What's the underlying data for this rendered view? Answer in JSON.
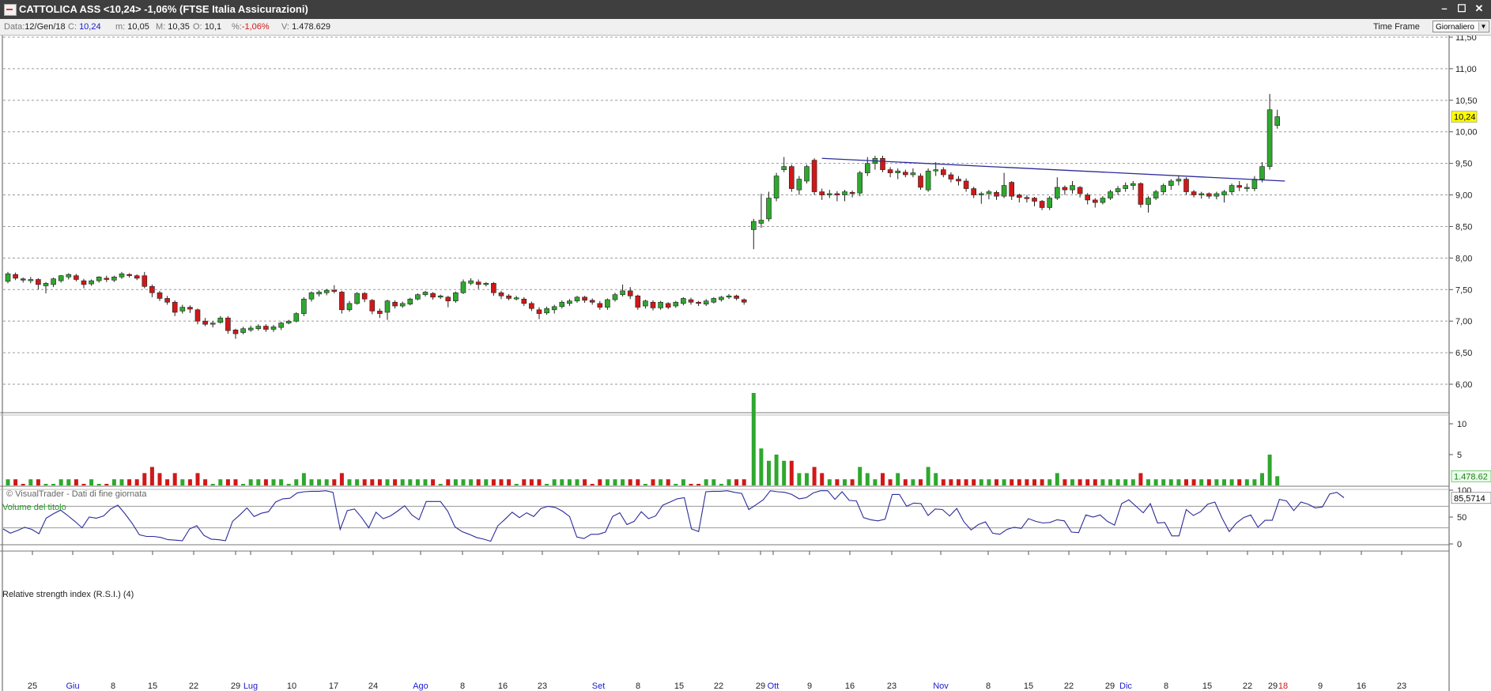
{
  "window": {
    "title": "CATTOLICA ASS <10,24>  -1,06%  (FTSE Italia Assicurazioni)",
    "buttons": [
      "–",
      "☐",
      "✕"
    ]
  },
  "infobar": {
    "data_label": "Data:",
    "data_value": "12/Gen/18",
    "close_label": "C:",
    "close_value": "10,24",
    "min_label": "m:",
    "min_value": "10,05",
    "max_label": "M:",
    "max_value": "10,35",
    "open_label": "O:",
    "open_value": "10,1",
    "pct_label": "%:",
    "pct_value": "-1,06%",
    "vol_label": "V:",
    "vol_value": "1.478.629",
    "timeframe_label": "Time Frame",
    "timeframe_value": "Giornaliero"
  },
  "colors": {
    "up": "#2ea82e",
    "down": "#d01818",
    "line": "#2b2b9a",
    "last_price_bg": "#ffff00"
  },
  "price_panel": {
    "watermark": "© VisualTrader - Dati di fine giornata",
    "axis_ticks": [
      "11,50",
      "11,00",
      "10,50",
      "10,00",
      "9,50",
      "9,00",
      "8,50",
      "8,00",
      "7,50",
      "7,00",
      "6,50",
      "6,00"
    ],
    "last_price": "10,24"
  },
  "volume_panel": {
    "title": "Volume del titolo",
    "axis_ticks": [
      "10",
      "5"
    ],
    "last_value": "1.478.62"
  },
  "rsi_panel": {
    "title": "Relative strength index (R.S.I.) (4)",
    "axis_ticks": [
      "100",
      "50",
      "0"
    ],
    "last_value": "85,5714"
  },
  "chart_data": {
    "type": "candlestick",
    "ylim": [
      5.6,
      11.6
    ],
    "x_axis_labels": [
      {
        "label": "25",
        "month": false
      },
      {
        "label": "Giu",
        "month": true
      },
      {
        "label": "8",
        "month": false
      },
      {
        "label": "15",
        "month": false
      },
      {
        "label": "22",
        "month": false
      },
      {
        "label": "29",
        "month": false
      },
      {
        "label": "Lug",
        "month": true
      },
      {
        "label": "10",
        "month": false
      },
      {
        "label": "17",
        "month": false
      },
      {
        "label": "24",
        "month": false
      },
      {
        "label": "Ago",
        "month": true
      },
      {
        "label": "8",
        "month": false
      },
      {
        "label": "16",
        "month": false
      },
      {
        "label": "23",
        "month": false
      },
      {
        "label": "Set",
        "month": true
      },
      {
        "label": "8",
        "month": false
      },
      {
        "label": "15",
        "month": false
      },
      {
        "label": "22",
        "month": false
      },
      {
        "label": "29",
        "month": false
      },
      {
        "label": "Ott",
        "month": true
      },
      {
        "label": "9",
        "month": false
      },
      {
        "label": "16",
        "month": false
      },
      {
        "label": "23",
        "month": false
      },
      {
        "label": "Nov",
        "month": true
      },
      {
        "label": "8",
        "month": false
      },
      {
        "label": "15",
        "month": false
      },
      {
        "label": "22",
        "month": false
      },
      {
        "label": "29",
        "month": false
      },
      {
        "label": "Dic",
        "month": true
      },
      {
        "label": "8",
        "month": false
      },
      {
        "label": "15",
        "month": false
      },
      {
        "label": "22",
        "month": false
      },
      {
        "label": "29",
        "month": false
      },
      {
        "label": "18",
        "month": true
      },
      {
        "label": "9",
        "month": false
      },
      {
        "label": "16",
        "month": false
      },
      {
        "label": "23",
        "month": false
      }
    ],
    "trendline": {
      "from": [
        107,
        9.58
      ],
      "to": [
        168,
        9.22
      ]
    },
    "candles": [
      [
        7.63,
        7.75,
        7.6,
        7.78,
        1
      ],
      [
        7.74,
        7.68,
        7.65,
        7.77,
        1
      ],
      [
        7.67,
        7.65,
        7.61,
        7.69,
        0
      ],
      [
        7.64,
        7.66,
        7.6,
        7.7,
        1
      ],
      [
        7.66,
        7.58,
        7.5,
        7.68,
        1
      ],
      [
        7.56,
        7.6,
        7.44,
        7.62,
        0
      ],
      [
        7.58,
        7.67,
        7.54,
        7.69,
        0
      ],
      [
        7.64,
        7.72,
        7.61,
        7.73,
        1
      ],
      [
        7.7,
        7.74,
        7.66,
        7.76,
        1
      ],
      [
        7.72,
        7.66,
        7.63,
        7.75,
        1
      ],
      [
        7.64,
        7.58,
        7.52,
        7.67,
        0
      ],
      [
        7.59,
        7.64,
        7.56,
        7.66,
        1
      ],
      [
        7.64,
        7.7,
        7.61,
        7.71,
        0
      ],
      [
        7.68,
        7.66,
        7.62,
        7.72,
        0
      ],
      [
        7.65,
        7.7,
        7.62,
        7.72,
        1
      ],
      [
        7.7,
        7.75,
        7.67,
        7.78,
        1
      ],
      [
        7.74,
        7.73,
        7.69,
        7.76,
        1
      ],
      [
        7.72,
        7.68,
        7.65,
        7.74,
        1
      ],
      [
        7.72,
        7.55,
        7.52,
        7.78,
        2
      ],
      [
        7.55,
        7.45,
        7.38,
        7.58,
        3
      ],
      [
        7.45,
        7.36,
        7.32,
        7.48,
        2
      ],
      [
        7.36,
        7.3,
        7.26,
        7.4,
        1
      ],
      [
        7.3,
        7.14,
        7.08,
        7.33,
        2
      ],
      [
        7.16,
        7.22,
        7.12,
        7.26,
        1
      ],
      [
        7.22,
        7.19,
        7.13,
        7.25,
        1
      ],
      [
        7.18,
        7.0,
        6.95,
        7.2,
        2
      ],
      [
        7.0,
        6.95,
        6.92,
        7.05,
        1
      ],
      [
        6.95,
        6.97,
        6.9,
        7.0,
        0
      ],
      [
        6.98,
        7.05,
        6.96,
        7.08,
        1
      ],
      [
        7.05,
        6.85,
        6.8,
        7.08,
        1
      ],
      [
        6.86,
        6.8,
        6.72,
        6.88,
        1
      ],
      [
        6.82,
        6.88,
        6.79,
        6.91,
        0
      ],
      [
        6.86,
        6.89,
        6.83,
        6.93,
        1
      ],
      [
        6.88,
        6.92,
        6.85,
        6.95,
        1
      ],
      [
        6.92,
        6.87,
        6.83,
        6.95,
        1
      ],
      [
        6.87,
        6.91,
        6.83,
        6.94,
        1
      ],
      [
        6.9,
        6.97,
        6.86,
        6.99,
        1
      ],
      [
        6.97,
        7.0,
        6.95,
        7.02,
        0
      ],
      [
        7.0,
        7.12,
        6.98,
        7.14,
        1
      ],
      [
        7.12,
        7.35,
        7.08,
        7.38,
        2
      ],
      [
        7.35,
        7.45,
        7.31,
        7.47,
        1
      ],
      [
        7.43,
        7.46,
        7.39,
        7.49,
        1
      ],
      [
        7.45,
        7.49,
        7.41,
        7.51,
        1
      ],
      [
        7.49,
        7.48,
        7.44,
        7.57,
        1
      ],
      [
        7.46,
        7.18,
        7.12,
        7.48,
        2
      ],
      [
        7.18,
        7.28,
        7.15,
        7.32,
        1
      ],
      [
        7.28,
        7.44,
        7.26,
        7.46,
        1
      ],
      [
        7.44,
        7.35,
        7.3,
        7.46,
        1
      ],
      [
        7.33,
        7.16,
        7.11,
        7.35,
        1
      ],
      [
        7.16,
        7.12,
        7.05,
        7.2,
        1
      ],
      [
        7.14,
        7.32,
        7.02,
        7.34,
        1
      ],
      [
        7.3,
        7.24,
        7.2,
        7.33,
        1
      ],
      [
        7.24,
        7.28,
        7.21,
        7.31,
        1
      ],
      [
        7.27,
        7.35,
        7.25,
        7.37,
        1
      ],
      [
        7.35,
        7.42,
        7.33,
        7.44,
        1
      ],
      [
        7.42,
        7.46,
        7.39,
        7.48,
        1
      ],
      [
        7.44,
        7.38,
        7.34,
        7.46,
        1
      ],
      [
        7.38,
        7.4,
        7.35,
        7.42,
        0
      ],
      [
        7.38,
        7.32,
        7.22,
        7.4,
        1
      ],
      [
        7.32,
        7.45,
        7.29,
        7.47,
        1
      ],
      [
        7.45,
        7.62,
        7.43,
        7.66,
        1
      ],
      [
        7.6,
        7.64,
        7.57,
        7.68,
        1
      ],
      [
        7.62,
        7.58,
        7.51,
        7.66,
        1
      ],
      [
        7.58,
        7.6,
        7.55,
        7.62,
        1
      ],
      [
        7.6,
        7.45,
        7.4,
        7.62,
        1
      ],
      [
        7.45,
        7.4,
        7.35,
        7.48,
        1
      ],
      [
        7.4,
        7.36,
        7.33,
        7.43,
        1
      ],
      [
        7.36,
        7.37,
        7.33,
        7.4,
        0
      ],
      [
        7.35,
        7.28,
        7.24,
        7.38,
        1
      ],
      [
        7.28,
        7.2,
        7.16,
        7.31,
        1
      ],
      [
        7.18,
        7.12,
        7.03,
        7.22,
        1
      ],
      [
        7.13,
        7.2,
        7.1,
        7.23,
        0
      ],
      [
        7.18,
        7.23,
        7.12,
        7.26,
        1
      ],
      [
        7.23,
        7.3,
        7.2,
        7.33,
        1
      ],
      [
        7.28,
        7.32,
        7.24,
        7.35,
        1
      ],
      [
        7.32,
        7.38,
        7.29,
        7.4,
        1
      ],
      [
        7.38,
        7.33,
        7.29,
        7.4,
        1
      ],
      [
        7.33,
        7.3,
        7.26,
        7.36,
        0
      ],
      [
        7.28,
        7.22,
        7.18,
        7.32,
        1
      ],
      [
        7.22,
        7.34,
        7.18,
        7.36,
        1
      ],
      [
        7.34,
        7.42,
        7.31,
        7.45,
        1
      ],
      [
        7.42,
        7.48,
        7.39,
        7.58,
        1
      ],
      [
        7.48,
        7.4,
        7.35,
        7.54,
        1
      ],
      [
        7.4,
        7.22,
        7.18,
        7.42,
        1
      ],
      [
        7.24,
        7.32,
        7.2,
        7.34,
        0
      ],
      [
        7.3,
        7.21,
        7.17,
        7.33,
        1
      ],
      [
        7.21,
        7.3,
        7.18,
        7.32,
        1
      ],
      [
        7.28,
        7.22,
        7.19,
        7.3,
        1
      ],
      [
        7.24,
        7.3,
        7.21,
        7.32,
        0
      ],
      [
        7.28,
        7.36,
        7.25,
        7.38,
        1
      ],
      [
        7.34,
        7.3,
        7.26,
        7.37,
        0
      ],
      [
        7.3,
        7.28,
        7.24,
        7.32,
        0
      ],
      [
        7.27,
        7.32,
        7.24,
        7.35,
        1
      ],
      [
        7.3,
        7.36,
        7.28,
        7.38,
        1
      ],
      [
        7.34,
        7.38,
        7.31,
        7.4,
        0
      ],
      [
        7.38,
        7.4,
        7.35,
        7.43,
        1
      ],
      [
        7.4,
        7.36,
        7.33,
        7.42,
        1
      ],
      [
        7.34,
        7.3,
        7.26,
        7.36,
        1
      ],
      [
        8.45,
        8.58,
        8.14,
        8.62,
        15
      ],
      [
        8.55,
        8.6,
        8.48,
        9.02,
        6
      ],
      [
        8.62,
        8.95,
        8.58,
        9.05,
        4
      ],
      [
        8.95,
        9.3,
        8.9,
        9.35,
        5
      ],
      [
        9.4,
        9.45,
        9.36,
        9.6,
        4
      ],
      [
        9.45,
        9.1,
        9.05,
        9.48,
        4
      ],
      [
        9.08,
        9.25,
        9.0,
        9.3,
        2
      ],
      [
        9.22,
        9.45,
        9.18,
        9.48,
        2
      ],
      [
        9.55,
        9.05,
        9.0,
        9.58,
        3
      ],
      [
        9.05,
        9.0,
        8.92,
        9.1,
        2
      ],
      [
        9.0,
        9.02,
        8.95,
        9.08,
        1
      ],
      [
        9.02,
        9.0,
        8.9,
        9.06,
        1
      ],
      [
        9.0,
        9.05,
        8.9,
        9.08,
        1
      ],
      [
        9.04,
        9.02,
        8.96,
        9.07,
        1
      ],
      [
        9.03,
        9.35,
        8.98,
        9.38,
        3
      ],
      [
        9.35,
        9.5,
        9.3,
        9.6,
        2
      ],
      [
        9.5,
        9.58,
        9.4,
        9.62,
        1
      ],
      [
        9.58,
        9.4,
        9.36,
        9.62,
        2
      ],
      [
        9.4,
        9.35,
        9.28,
        9.44,
        1
      ],
      [
        9.35,
        9.38,
        9.25,
        9.42,
        2
      ],
      [
        9.36,
        9.32,
        9.28,
        9.4,
        1
      ],
      [
        9.32,
        9.35,
        9.28,
        9.42,
        1
      ],
      [
        9.3,
        9.12,
        9.08,
        9.34,
        1
      ],
      [
        9.08,
        9.38,
        9.05,
        9.42,
        3
      ],
      [
        9.38,
        9.4,
        9.3,
        9.52,
        2
      ],
      [
        9.4,
        9.32,
        9.28,
        9.44,
        1
      ],
      [
        9.32,
        9.25,
        9.2,
        9.36,
        1
      ],
      [
        9.25,
        9.22,
        9.15,
        9.3,
        1
      ],
      [
        9.22,
        9.1,
        9.05,
        9.26,
        1
      ],
      [
        9.1,
        9.0,
        8.95,
        9.13,
        1
      ],
      [
        9.0,
        9.02,
        8.86,
        9.05,
        1
      ],
      [
        9.02,
        9.05,
        8.93,
        9.08,
        1
      ],
      [
        9.04,
        8.98,
        8.92,
        9.07,
        1
      ],
      [
        8.98,
        9.15,
        8.95,
        9.35,
        1
      ],
      [
        9.2,
        8.98,
        8.92,
        9.22,
        1
      ],
      [
        9.0,
        8.96,
        8.88,
        9.02,
        1
      ],
      [
        8.96,
        8.95,
        8.88,
        9.0,
        1
      ],
      [
        8.95,
        8.9,
        8.82,
        8.97,
        1
      ],
      [
        8.9,
        8.8,
        8.76,
        8.92,
        1
      ],
      [
        8.8,
        8.95,
        8.76,
        8.98,
        1
      ],
      [
        8.95,
        9.12,
        8.92,
        9.28,
        2
      ],
      [
        9.12,
        9.08,
        9.0,
        9.15,
        1
      ],
      [
        9.08,
        9.15,
        9.02,
        9.22,
        1
      ],
      [
        9.12,
        9.02,
        8.96,
        9.14,
        1
      ],
      [
        9.0,
        8.92,
        8.85,
        9.03,
        1
      ],
      [
        8.92,
        8.88,
        8.8,
        8.95,
        1
      ],
      [
        8.88,
        8.95,
        8.85,
        8.98,
        1
      ],
      [
        8.95,
        9.05,
        8.92,
        9.08,
        1
      ],
      [
        9.05,
        9.1,
        9.0,
        9.14,
        1
      ],
      [
        9.1,
        9.15,
        9.05,
        9.2,
        1
      ],
      [
        9.15,
        9.18,
        9.08,
        9.22,
        1
      ],
      [
        9.18,
        8.85,
        8.8,
        9.2,
        2
      ],
      [
        8.85,
        8.95,
        8.72,
        8.98,
        1
      ],
      [
        8.95,
        9.05,
        8.92,
        9.08,
        1
      ],
      [
        9.05,
        9.15,
        9.0,
        9.18,
        1
      ],
      [
        9.15,
        9.22,
        9.08,
        9.25,
        1
      ],
      [
        9.22,
        9.25,
        9.15,
        9.3,
        1
      ],
      [
        9.25,
        9.05,
        9.0,
        9.28,
        1
      ],
      [
        9.05,
        9.0,
        8.96,
        9.08,
        1
      ],
      [
        9.0,
        9.02,
        8.94,
        9.05,
        1
      ],
      [
        9.02,
        8.98,
        8.94,
        9.04,
        1
      ],
      [
        8.98,
        9.02,
        8.93,
        9.05,
        1
      ],
      [
        9.0,
        9.05,
        8.88,
        9.08,
        1
      ],
      [
        9.05,
        9.15,
        9.0,
        9.18,
        1
      ],
      [
        9.15,
        9.12,
        9.06,
        9.22,
        1
      ],
      [
        9.1,
        9.12,
        9.05,
        9.18,
        1
      ],
      [
        9.1,
        9.25,
        9.06,
        9.3,
        1
      ],
      [
        9.25,
        9.45,
        9.2,
        9.52,
        2
      ],
      [
        9.45,
        10.35,
        9.4,
        10.6,
        5
      ],
      [
        10.1,
        10.24,
        10.05,
        10.35,
        1.5
      ]
    ],
    "rsi": [
      28,
      20,
      25,
      31,
      27,
      19,
      48,
      56,
      63,
      53,
      42,
      30,
      50,
      48,
      52,
      65,
      72,
      56,
      38,
      17,
      14,
      14,
      12,
      8,
      7,
      6,
      28,
      34,
      16,
      9,
      8,
      6,
      42,
      54,
      67,
      51,
      57,
      60,
      78,
      84,
      85,
      95,
      97,
      98,
      98,
      99,
      96,
      27,
      62,
      65,
      49,
      30,
      59,
      47,
      52,
      61,
      71,
      54,
      45,
      79,
      79,
      79,
      61,
      32,
      23,
      18,
      12,
      9,
      5,
      34,
      46,
      59,
      49,
      58,
      51,
      66,
      70,
      68,
      61,
      51,
      13,
      10,
      18,
      18,
      22,
      51,
      58,
      36,
      42,
      60,
      47,
      52,
      72,
      78,
      84,
      86,
      28,
      23,
      97,
      98,
      98,
      99,
      96,
      94,
      64,
      73,
      82,
      99,
      97,
      96,
      92,
      84,
      86,
      95,
      99,
      99,
      83,
      97,
      81,
      80,
      49,
      45,
      43,
      46,
      92,
      92,
      70,
      76,
      75,
      53,
      65,
      64,
      52,
      66,
      41,
      26,
      36,
      41,
      20,
      18,
      27,
      31,
      29,
      47,
      42,
      39,
      40,
      45,
      43,
      22,
      21,
      54,
      50,
      54,
      42,
      35,
      75,
      82,
      70,
      58,
      75,
      39,
      40,
      15,
      15,
      64,
      53,
      60,
      74,
      78,
      48,
      23,
      39,
      49,
      54,
      31,
      44,
      44,
      83,
      80,
      62,
      78,
      74,
      67,
      69,
      93,
      96,
      86
    ]
  }
}
